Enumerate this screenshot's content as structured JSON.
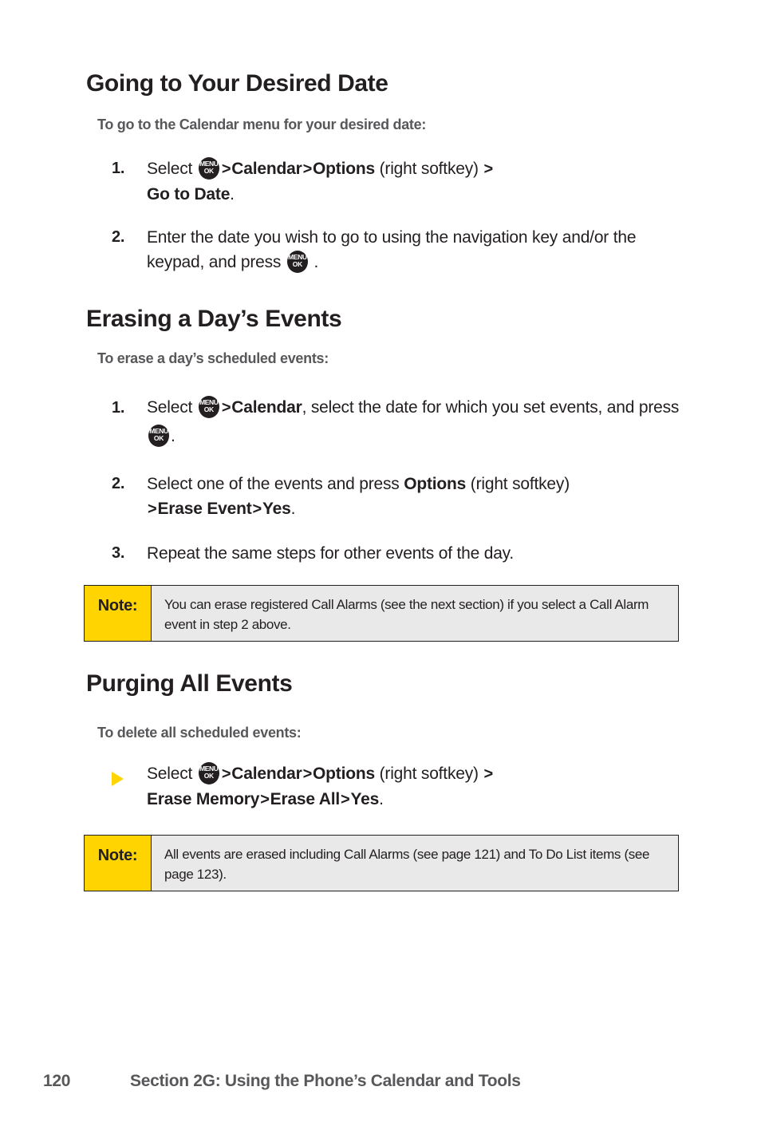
{
  "page": {
    "number": "120",
    "footer_text": "Section 2G: Using the Phone’s Calendar and Tools"
  },
  "icons": {
    "menu_key": {
      "name": "menu-ok-key-icon",
      "line1": "MENU",
      "line2": "OK"
    },
    "triangle_bullet": {
      "name": "triangle-bullet-icon",
      "color": "#FFD400"
    }
  },
  "colors": {
    "heading": "#231F20",
    "subheading": "#58585B",
    "note_label_bg": "#FFD400",
    "note_body_bg": "#E9E9E9",
    "note_border": "#231F20",
    "footer_text": "#58585B",
    "bullet_yellow": "#FFD400"
  },
  "sections": [
    {
      "heading": "Going to Your Desired Date",
      "lead": "To go to the Calendar menu for your desired date:",
      "steps": [
        {
          "marker": "1.",
          "parts": [
            {
              "type": "text",
              "value": "Select "
            },
            {
              "type": "menukey"
            },
            {
              "type": "chevron",
              "value": ">"
            },
            {
              "type": "bold",
              "value": "Calendar"
            },
            {
              "type": "chevron",
              "value": ">"
            },
            {
              "type": "bold",
              "value": "Options"
            },
            {
              "type": "text",
              "value": " (right softkey) "
            },
            {
              "type": "chevron",
              "value": ">"
            },
            {
              "type": "bold",
              "value": " Go to Date"
            },
            {
              "type": "text",
              "value": "."
            }
          ]
        },
        {
          "marker": "2.",
          "parts": [
            {
              "type": "text",
              "value": "Enter the date you wish to go to using the navigation key and/or the keypad, and press "
            },
            {
              "type": "menukey"
            },
            {
              "type": "text",
              "value": " ."
            }
          ]
        }
      ],
      "note": null
    },
    {
      "heading": "Erasing a Day’s Events",
      "lead": "To erase a day’s scheduled events:",
      "steps": [
        {
          "marker": "1.",
          "parts": [
            {
              "type": "text",
              "value": "Select "
            },
            {
              "type": "menukey"
            },
            {
              "type": "chevron",
              "value": ">"
            },
            {
              "type": "bold",
              "value": "Calendar"
            },
            {
              "type": "text",
              "value": ", select the date for which you set events, and press "
            },
            {
              "type": "menukey"
            },
            {
              "type": "text",
              "value": "."
            }
          ]
        },
        {
          "marker": "2.",
          "parts": [
            {
              "type": "text",
              "value": "Select one of the events and press "
            },
            {
              "type": "bold",
              "value": "Options"
            },
            {
              "type": "text",
              "value": " (right softkey) "
            },
            {
              "type": "chevron",
              "value": ">"
            },
            {
              "type": "bold",
              "value": " Erase Event"
            },
            {
              "type": "chevron",
              "value": ">"
            },
            {
              "type": "bold",
              "value": "Yes"
            },
            {
              "type": "text",
              "value": "."
            }
          ]
        },
        {
          "marker": "3.",
          "parts": [
            {
              "type": "text",
              "value": "Repeat the same steps for other events of the day."
            }
          ]
        }
      ],
      "note": {
        "label": "Note:",
        "text": "You can erase registered Call Alarms (see the next section) if you select a Call Alarm event in step 2 above."
      }
    },
    {
      "heading": "Purging All Events",
      "lead": "To delete all scheduled events:",
      "steps": [
        {
          "marker": "triangle",
          "parts": [
            {
              "type": "text",
              "value": "Select "
            },
            {
              "type": "menukey"
            },
            {
              "type": "chevron",
              "value": ">"
            },
            {
              "type": "bold",
              "value": "Calendar"
            },
            {
              "type": "chevron",
              "value": ">"
            },
            {
              "type": "bold",
              "value": "Options"
            },
            {
              "type": "text",
              "value": " (right softkey) "
            },
            {
              "type": "chevron",
              "value": ">"
            },
            {
              "type": "bold",
              "value": " Erase Memory"
            },
            {
              "type": "chevron",
              "value": ">"
            },
            {
              "type": "bold",
              "value": "Erase All"
            },
            {
              "type": "chevron",
              "value": ">"
            },
            {
              "type": "bold",
              "value": "Yes"
            },
            {
              "type": "text",
              "value": "."
            }
          ]
        }
      ],
      "note": {
        "label": "Note:",
        "text": "All events are erased including Call Alarms (see page 121) and To Do List items (see page 123)."
      }
    }
  ]
}
